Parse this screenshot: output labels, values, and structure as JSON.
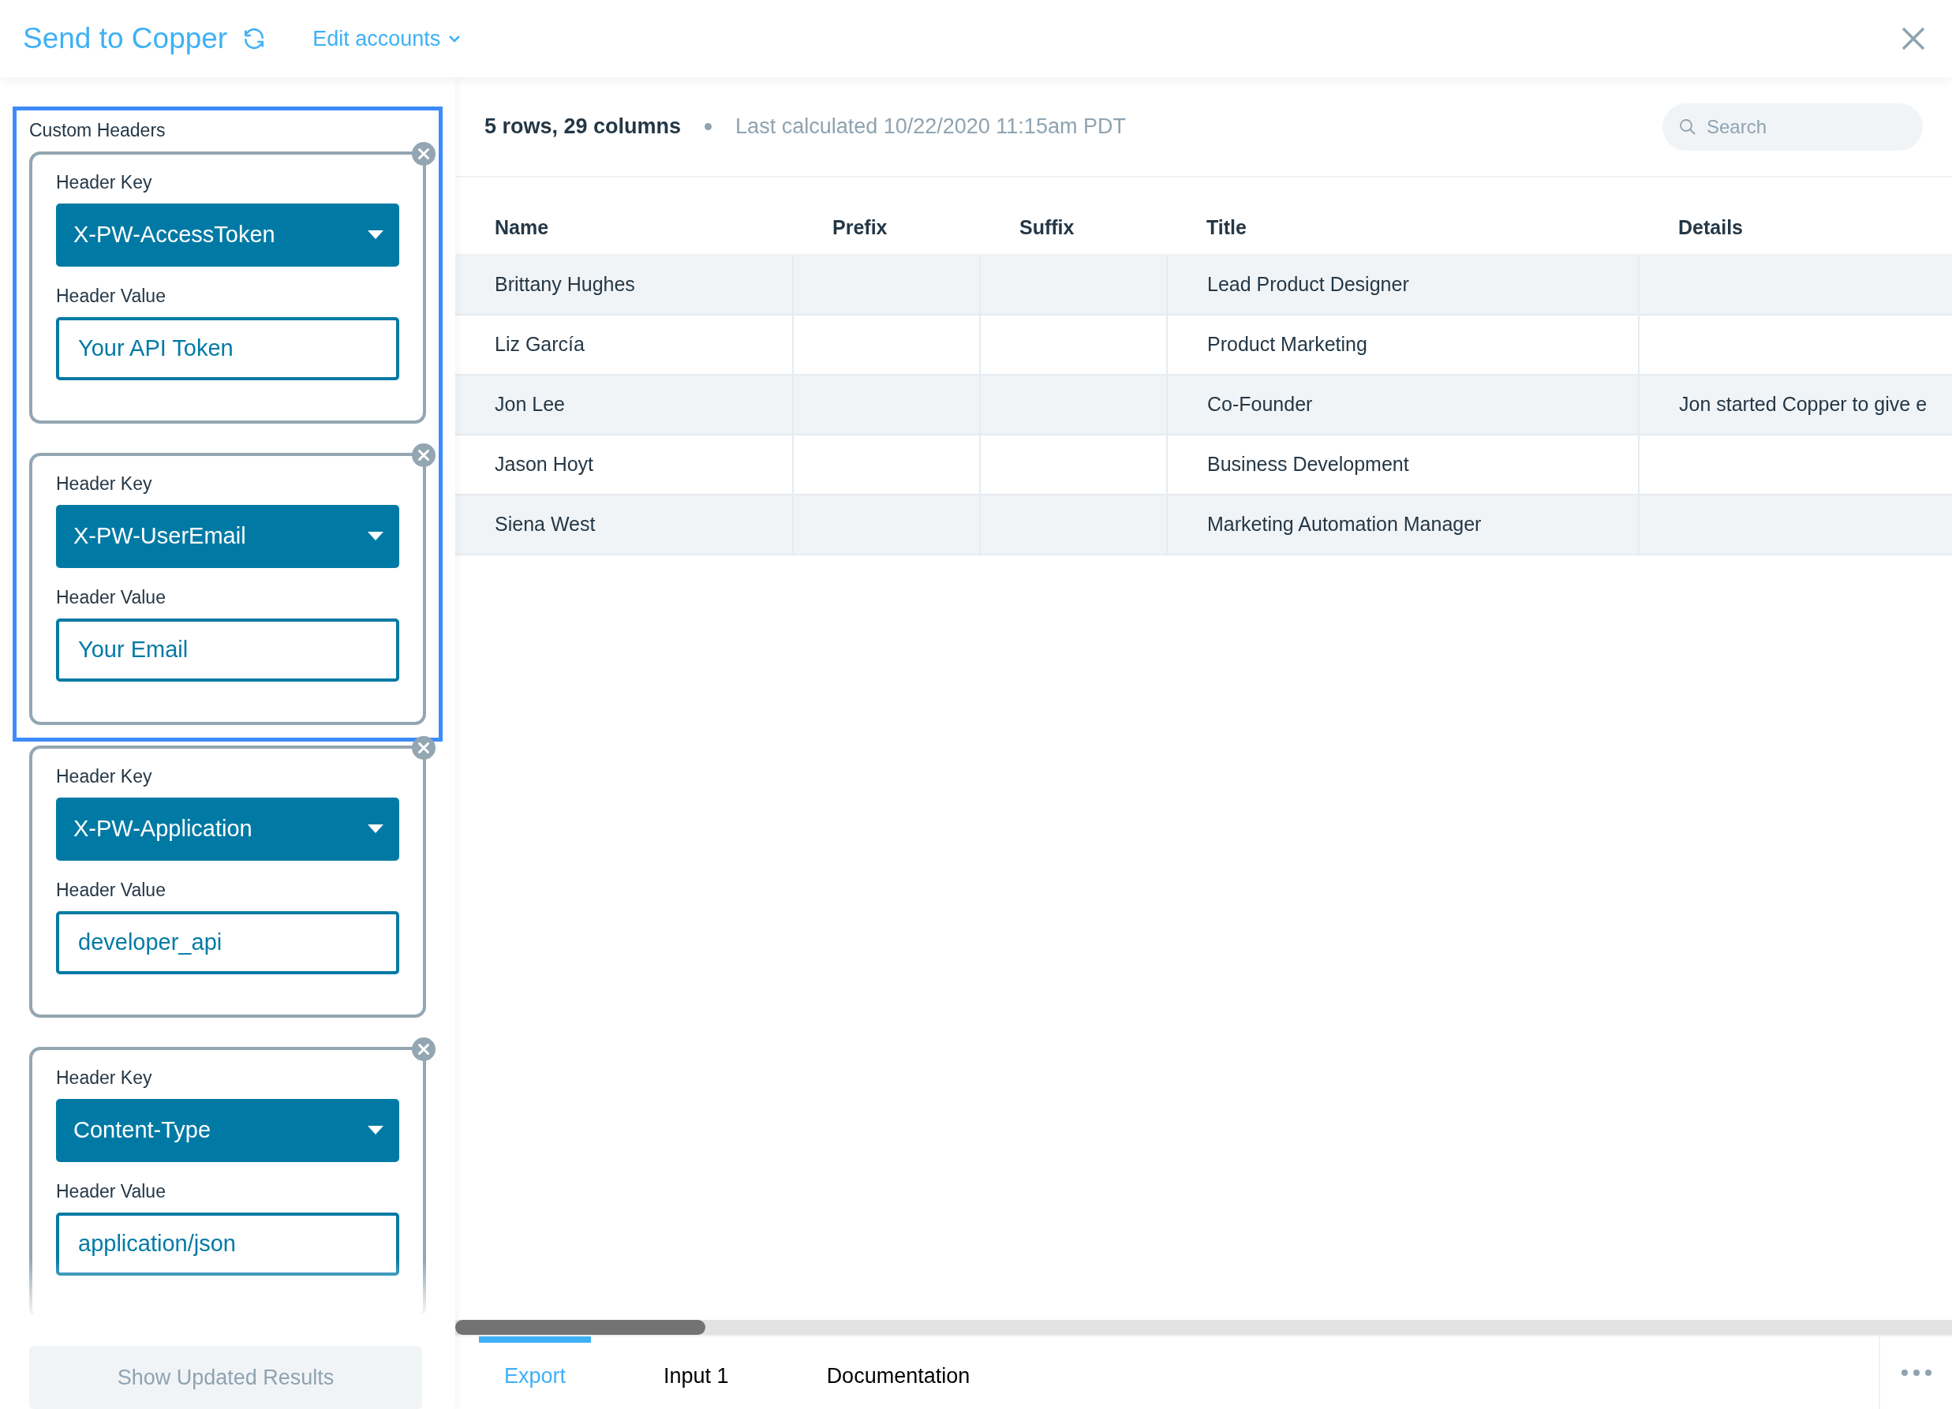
{
  "header": {
    "title": "Send to Copper",
    "accounts_menu": "Edit accounts"
  },
  "header_groups": [
    {
      "title": "Custom Headers",
      "outlined": true,
      "headers": [
        {
          "key_label": "Header Key",
          "key": "X-PW-AccessToken",
          "value_label": "Header Value",
          "value": "Your API Token"
        },
        {
          "key_label": "Header Key",
          "key": "X-PW-UserEmail",
          "value_label": "Header Value",
          "value": "Your Email"
        }
      ]
    },
    {
      "headers": [
        {
          "key_label": "Header Key",
          "key": "X-PW-Application",
          "value_label": "Header Value",
          "value": "developer_api"
        },
        {
          "key_label": "Header Key",
          "key": "Content-Type",
          "value_label": "Header Value",
          "value": "application/json"
        }
      ]
    }
  ],
  "show_results_button": "Show Updated Results",
  "summary": {
    "counts": "5 rows, 29 columns",
    "calculated": "Last calculated 10/22/2020 11:15am PDT"
  },
  "search": {
    "placeholder": "Search"
  },
  "table": {
    "columns": [
      "Name",
      "Prefix",
      "Suffix",
      "Title",
      "Details"
    ],
    "rows": [
      [
        "Brittany Hughes",
        "",
        "",
        "Lead Product Designer",
        ""
      ],
      [
        "Liz García",
        "",
        "",
        "Product Marketing",
        ""
      ],
      [
        "Jon Lee",
        "",
        "",
        "Co-Founder",
        "Jon started Copper to give e"
      ],
      [
        "Jason Hoyt",
        "",
        "",
        "Business Development",
        ""
      ],
      [
        "Siena West",
        "",
        "",
        "Marketing Automation Manager",
        ""
      ]
    ]
  },
  "tabs": [
    {
      "label": "Export",
      "selected": true
    },
    {
      "label": "Input 1",
      "selected": false
    },
    {
      "label": "Documentation",
      "selected": false
    }
  ]
}
